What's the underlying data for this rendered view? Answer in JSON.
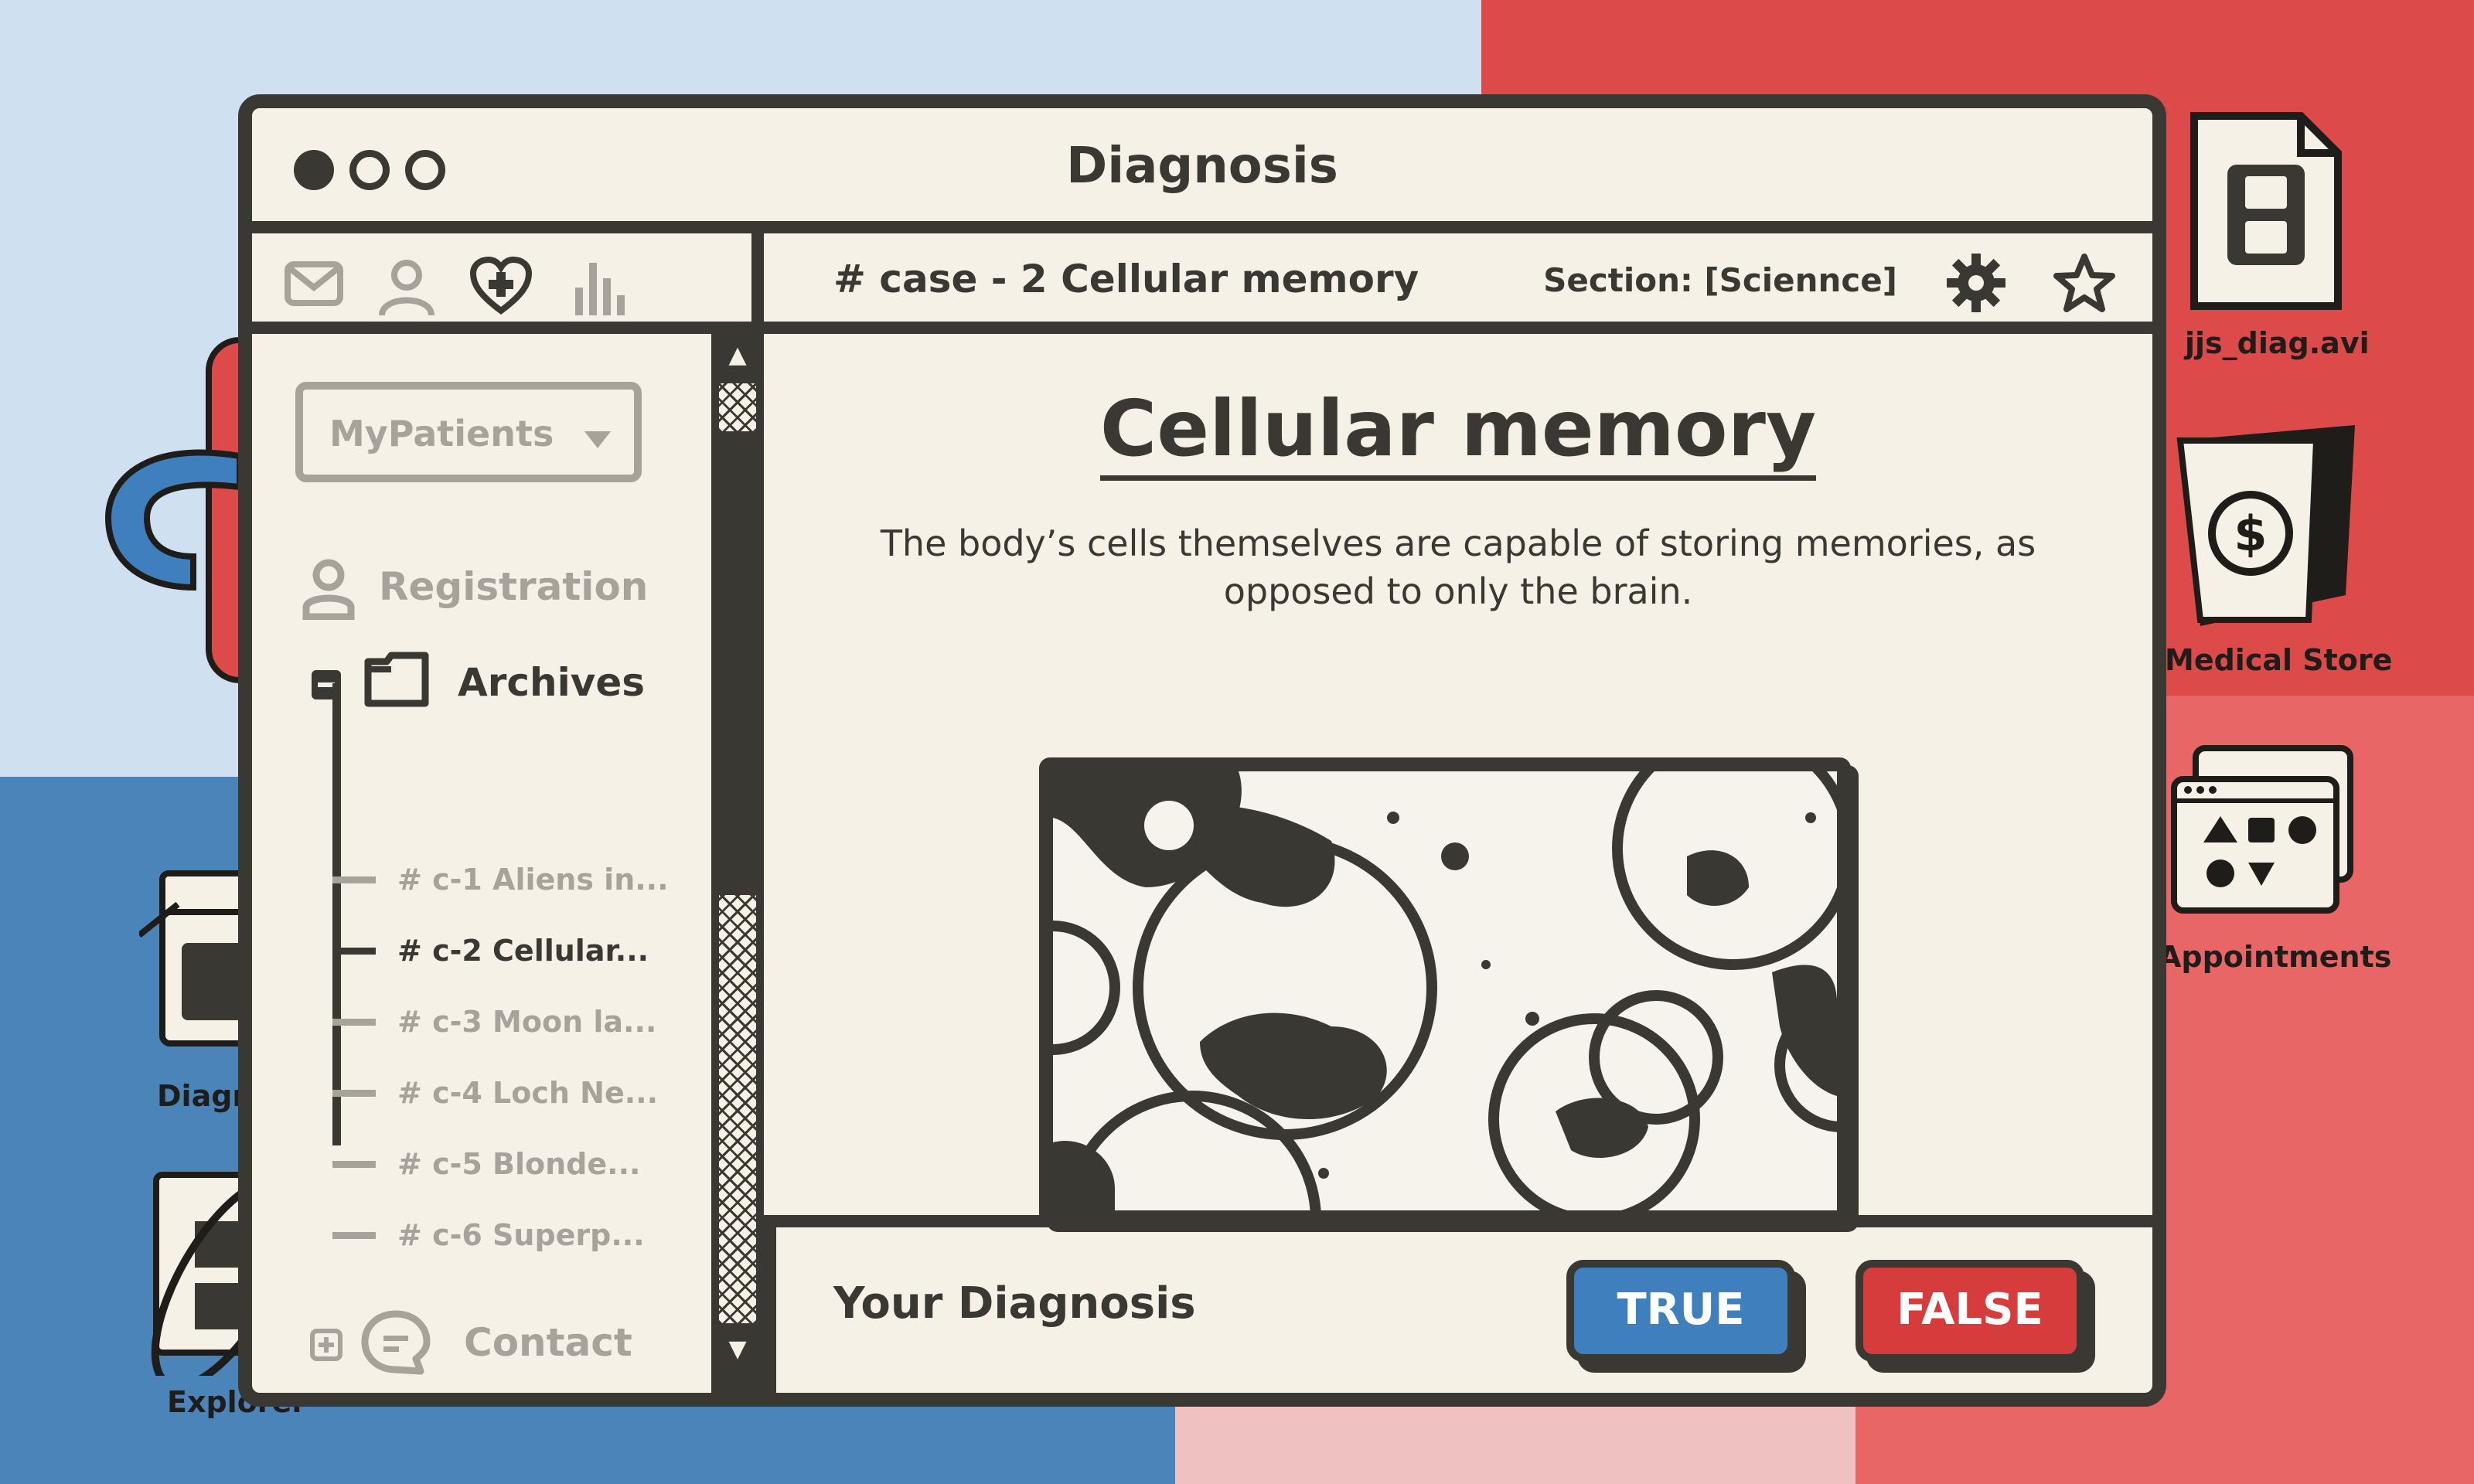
{
  "desktop": {
    "icons": [
      {
        "name": "jjs_diag.avi",
        "icon": "video-file-icon"
      },
      {
        "name": "Medical Store",
        "icon": "store-bag-icon"
      },
      {
        "name": "Appointments",
        "icon": "appointments-folder-icon"
      },
      {
        "name": "Diagn",
        "icon": "diagnosis-folder-icon"
      },
      {
        "name": "Explorer",
        "icon": "explorer-icon"
      }
    ]
  },
  "window": {
    "title": "Diagnosis",
    "toolbar_icons": [
      "mail-icon",
      "user-icon",
      "heart-plus-icon",
      "bar-chart-icon"
    ]
  },
  "case_header": {
    "title": "# case - 2 Cellular memory",
    "section": "Section: [Sciennce]",
    "icons": [
      "gear-icon",
      "star-icon"
    ]
  },
  "sidebar": {
    "dropdown": "MyPatients",
    "registration": "Registration",
    "archives": "Archives",
    "archive_items": [
      {
        "label": "# c-1 Aliens in...",
        "active": false
      },
      {
        "label": "# c-2 Cellular...",
        "active": true
      },
      {
        "label": "# c-3 Moon la...",
        "active": false
      },
      {
        "label": "# c-4 Loch Ne...",
        "active": false
      },
      {
        "label": "# c-5 Blonde...",
        "active": false
      },
      {
        "label": "# c-6 Superp...",
        "active": false
      }
    ],
    "contact": "Contact"
  },
  "content": {
    "title": "Cellular memory",
    "description": "The body’s cells themselves are capable of storing memories, as opposed to only the brain."
  },
  "footer": {
    "label": "Your Diagnosis",
    "true_label": "TRUE",
    "false_label": "FALSE"
  },
  "colors": {
    "ink": "#3a3833",
    "paper": "#f6f1e6",
    "muted": "#a6a39a",
    "true_blue": "#3f7fbd",
    "false_red": "#d63c3c"
  }
}
